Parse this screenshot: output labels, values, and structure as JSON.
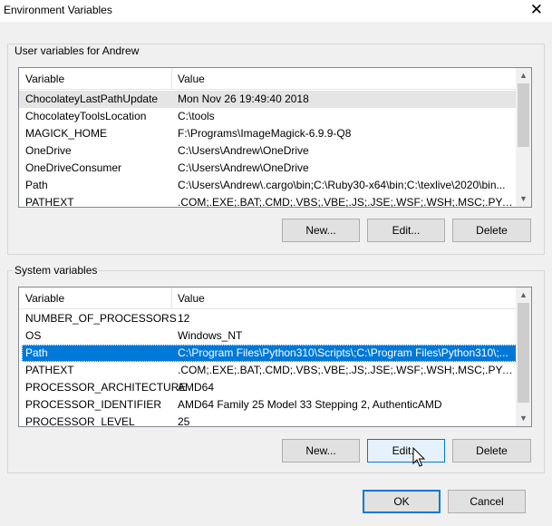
{
  "window": {
    "title": "Environment Variables",
    "close_glyph": "✕"
  },
  "user_vars": {
    "group_label": "User variables for Andrew",
    "headers": {
      "variable": "Variable",
      "value": "Value"
    },
    "rows": [
      {
        "variable": "ChocolateyLastPathUpdate",
        "value": "Mon Nov 26 19:49:40 2018"
      },
      {
        "variable": "ChocolateyToolsLocation",
        "value": "C:\\tools"
      },
      {
        "variable": "MAGICK_HOME",
        "value": "F:\\Programs\\ImageMagick-6.9.9-Q8"
      },
      {
        "variable": "OneDrive",
        "value": "C:\\Users\\Andrew\\OneDrive"
      },
      {
        "variable": "OneDriveConsumer",
        "value": "C:\\Users\\Andrew\\OneDrive"
      },
      {
        "variable": "Path",
        "value": "C:\\Users\\Andrew\\.cargo\\bin;C:\\Ruby30-x64\\bin;C:\\texlive\\2020\\bin..."
      },
      {
        "variable": "PATHEXT",
        "value": ".COM;.EXE;.BAT;.CMD;.VBS;.VBE;.JS;.JSE;.WSF;.WSH;.MSC;.PY;.PYW;...."
      }
    ],
    "buttons": {
      "new": "New...",
      "edit": "Edit...",
      "delete": "Delete"
    }
  },
  "system_vars": {
    "group_label": "System variables",
    "headers": {
      "variable": "Variable",
      "value": "Value"
    },
    "rows": [
      {
        "variable": "NUMBER_OF_PROCESSORS",
        "value": "12"
      },
      {
        "variable": "OS",
        "value": "Windows_NT"
      },
      {
        "variable": "Path",
        "value": "C:\\Program Files\\Python310\\Scripts\\;C:\\Program Files\\Python310\\;..."
      },
      {
        "variable": "PATHEXT",
        "value": ".COM;.EXE;.BAT;.CMD;.VBS;.VBE;.JS;.JSE;.WSF;.WSH;.MSC;.PY;.PYW"
      },
      {
        "variable": "PROCESSOR_ARCHITECTURE",
        "value": "AMD64"
      },
      {
        "variable": "PROCESSOR_IDENTIFIER",
        "value": "AMD64 Family 25 Model 33 Stepping 2, AuthenticAMD"
      },
      {
        "variable": "PROCESSOR_LEVEL",
        "value": "25"
      }
    ],
    "selected_variable": "Path",
    "buttons": {
      "new": "New...",
      "edit": "Edit...",
      "delete": "Delete"
    }
  },
  "footer": {
    "ok": "OK",
    "cancel": "Cancel"
  },
  "colors": {
    "accent": "#0078d7",
    "window_bg": "#f0f0f0",
    "button_bg": "#e1e1e1"
  }
}
